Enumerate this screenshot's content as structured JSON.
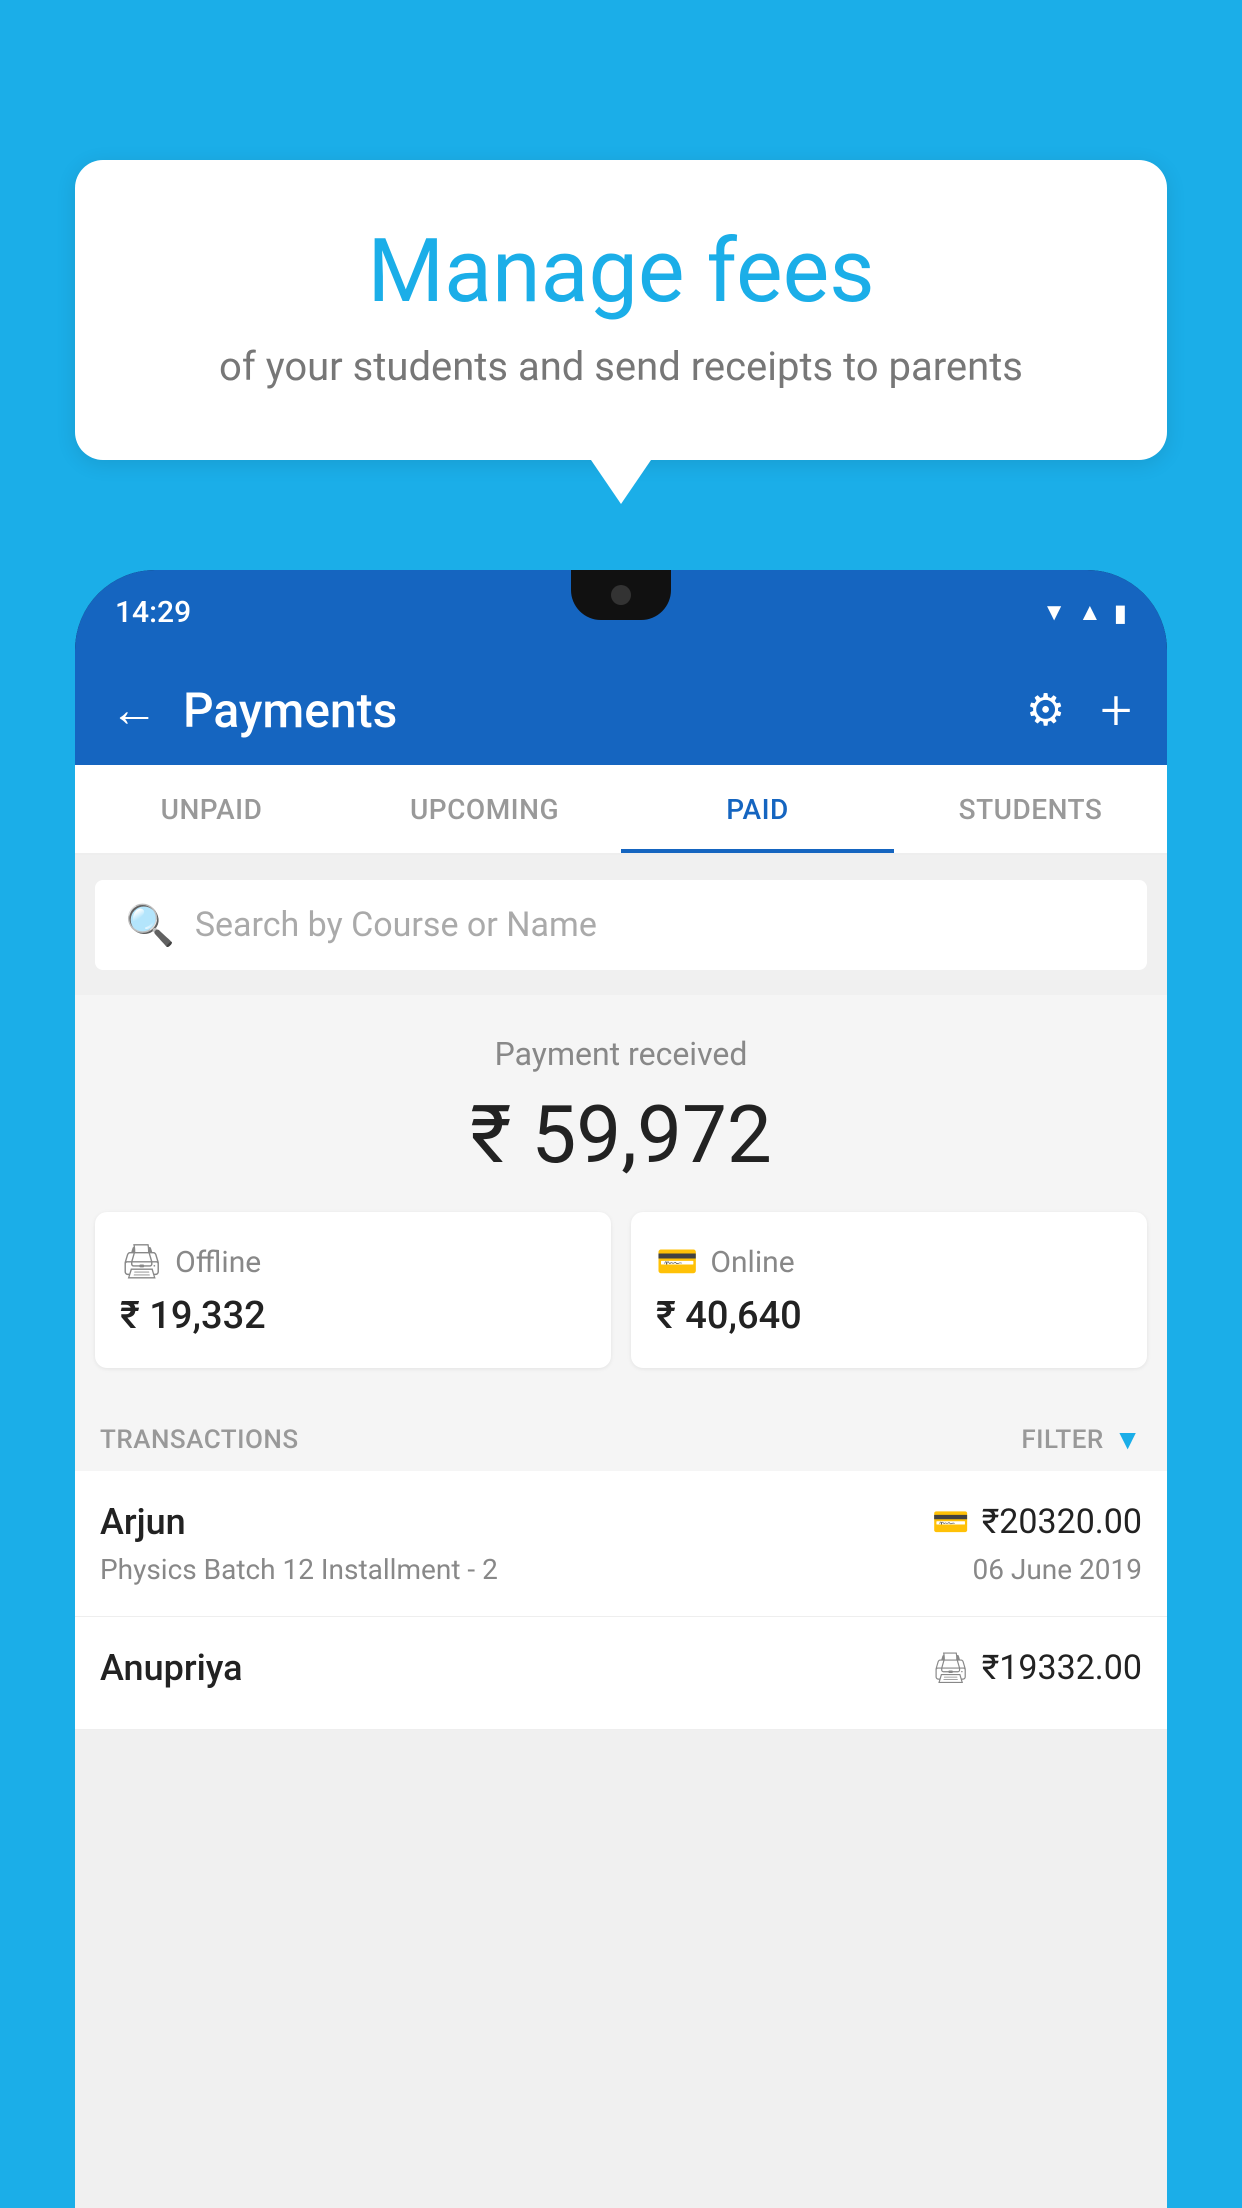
{
  "background_color": "#1BAEE8",
  "speech_bubble": {
    "title": "Manage fees",
    "subtitle": "of your students and send receipts to parents"
  },
  "status_bar": {
    "time": "14:29"
  },
  "app_header": {
    "title": "Payments",
    "back_label": "←",
    "settings_label": "⚙",
    "add_label": "+"
  },
  "tabs": [
    {
      "id": "unpaid",
      "label": "UNPAID",
      "active": false
    },
    {
      "id": "upcoming",
      "label": "UPCOMING",
      "active": false
    },
    {
      "id": "paid",
      "label": "PAID",
      "active": true
    },
    {
      "id": "students",
      "label": "STUDENTS",
      "active": false
    }
  ],
  "search": {
    "placeholder": "Search by Course or Name"
  },
  "payment_summary": {
    "label": "Payment received",
    "amount": "₹ 59,972"
  },
  "payment_cards": [
    {
      "id": "offline",
      "label": "Offline",
      "amount": "₹ 19,332",
      "icon": "🖨"
    },
    {
      "id": "online",
      "label": "Online",
      "amount": "₹ 40,640",
      "icon": "💳"
    }
  ],
  "transactions_section": {
    "label": "TRANSACTIONS",
    "filter_label": "FILTER"
  },
  "transactions": [
    {
      "id": 1,
      "name": "Arjun",
      "course": "Physics Batch 12 Installment - 2",
      "amount": "₹20320.00",
      "date": "06 June 2019",
      "payment_type": "online"
    },
    {
      "id": 2,
      "name": "Anupriya",
      "course": "",
      "amount": "₹19332.00",
      "date": "",
      "payment_type": "offline"
    }
  ]
}
